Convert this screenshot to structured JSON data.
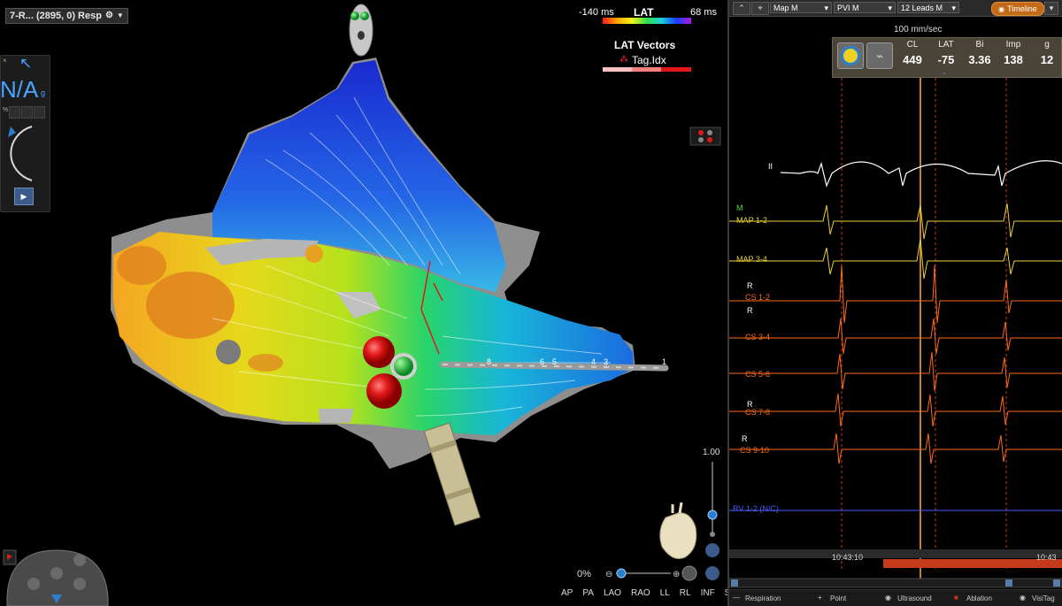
{
  "map": {
    "title": "7-R... (2895, 0) Resp",
    "lat_min": "-140 ms",
    "lat_title": "LAT",
    "lat_max": "68 ms",
    "vectors_title": "LAT Vectors",
    "tag_label": "Tag.Idx",
    "na_text": "N/A",
    "na_sub": "g",
    "percent": "%",
    "zoom": "0%",
    "scale": "1.00",
    "views": [
      "AP",
      "PA",
      "LAO",
      "RAO",
      "LL",
      "RL",
      "INF",
      "SUP"
    ],
    "electrode_labels": [
      "8",
      "6",
      "5",
      "4",
      "3",
      "1"
    ],
    "colors": {
      "accent_blue": "#4aa3ff",
      "ablation": "#d41e1e",
      "timeline": "#c26a18"
    }
  },
  "ecg": {
    "toolbar": {
      "map_select": "Map M",
      "pvi_select": "PVI M",
      "leads_select": "12 Leads M",
      "timeline_label": "Timeline"
    },
    "speed": "100 mm/sec",
    "measurements": {
      "headers": [
        "CL",
        "LAT",
        "Bi",
        "Imp",
        "g"
      ],
      "values": [
        "449",
        "-75",
        "3.36",
        "138",
        "12"
      ]
    },
    "channels": [
      {
        "label": "II",
        "color": "#ffffff"
      },
      {
        "label": "M",
        "color": "#55dd44"
      },
      {
        "label": "MAP 1-2",
        "color": "#e8d23a"
      },
      {
        "label": "MAP 3-4",
        "color": "#e8d23a"
      },
      {
        "label": "R",
        "color": "#ffffff"
      },
      {
        "label": "CS 1-2",
        "color": "#ff6a1a"
      },
      {
        "label": "R",
        "color": "#ffffff"
      },
      {
        "label": "CS 3-4",
        "color": "#ff6a1a"
      },
      {
        "label": "CS 5-6",
        "color": "#ff6a1a"
      },
      {
        "label": "R",
        "color": "#ffffff"
      },
      {
        "label": "CS 7-8",
        "color": "#ff6a1a"
      },
      {
        "label": "R",
        "color": "#ffffff"
      },
      {
        "label": "CS 9-10",
        "color": "#ff6a1a"
      },
      {
        "label": "RV 1-2 (N/C)",
        "color": "#4a5cff"
      }
    ],
    "time_a": "10:43:10",
    "time_b": "10:43",
    "legend": [
      "Respiration",
      "Point",
      "Ultrasound",
      "Ablation",
      "VisiTag"
    ]
  }
}
